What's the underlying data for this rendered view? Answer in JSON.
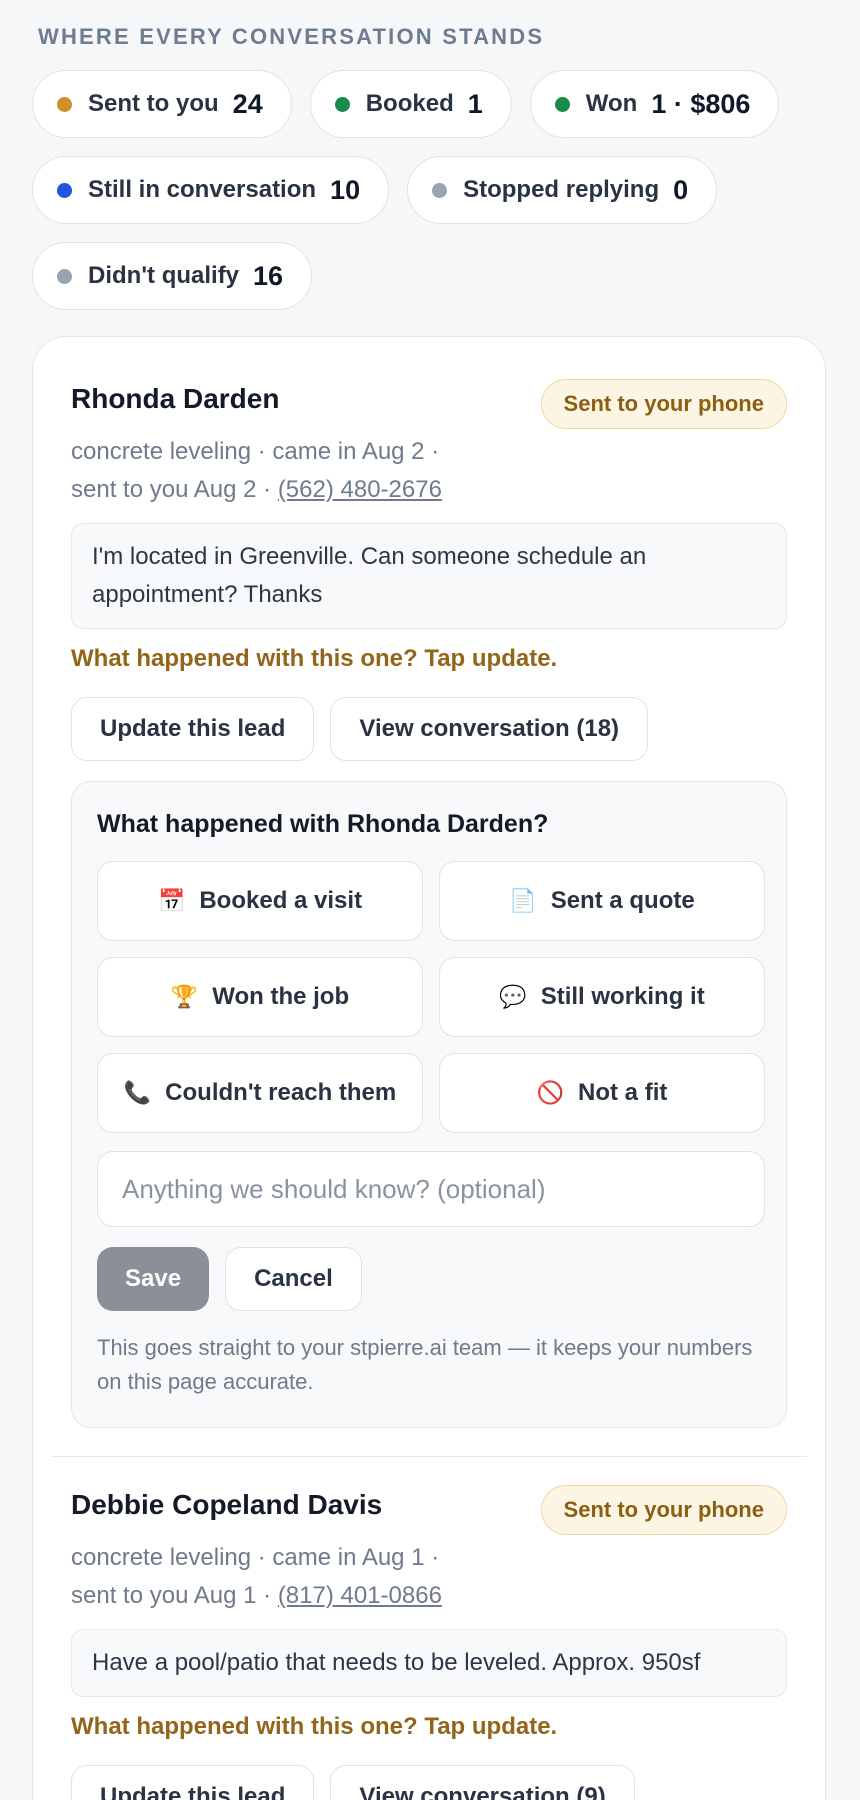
{
  "summary": {
    "heading": "WHERE EVERY CONVERSATION STANDS",
    "chips": [
      {
        "label": "Sent to you",
        "value": "24",
        "color": "#d18f2c"
      },
      {
        "label": "Booked",
        "value": "1",
        "color": "#1a8a4a"
      },
      {
        "label": "Won",
        "value": "1 · $806",
        "color": "#1a8a4a"
      },
      {
        "label": "Still in conversation",
        "value": "10",
        "color": "#1f55e0"
      },
      {
        "label": "Stopped replying",
        "value": "0",
        "color": "#9aa3b2"
      },
      {
        "label": "Didn't qualify",
        "value": "16",
        "color": "#9aa3b2"
      }
    ]
  },
  "leads": [
    {
      "name": "Rhonda Darden",
      "badge": "Sent to your phone",
      "meta_line1": "concrete leveling · came in Aug 2 ·",
      "meta_line2_prefix": "sent to you Aug 2 · ",
      "phone": "(562) 480-2676",
      "message": "I'm located in Greenville. Can someone schedule an appointment? Thanks",
      "prompt": "What happened with this one? Tap update.",
      "update_label": "Update this lead",
      "view_label": "View conversation (18)",
      "panel": {
        "title": "What happened with Rhonda Darden?",
        "options": [
          {
            "icon": "📅",
            "icon_name": "calendar-icon",
            "label": "Booked a visit"
          },
          {
            "icon": "📄",
            "icon_name": "document-icon",
            "label": "Sent a quote"
          },
          {
            "icon": "🏆",
            "icon_name": "trophy-icon",
            "label": "Won the job"
          },
          {
            "icon": "💬",
            "icon_name": "speech-bubble-icon",
            "label": "Still working it"
          },
          {
            "icon": "📞",
            "icon_name": "phone-icon",
            "label": "Couldn't reach them"
          },
          {
            "icon": "🚫",
            "icon_name": "prohibited-icon",
            "label": "Not a fit"
          }
        ],
        "notes_placeholder": "Anything we should know? (optional)",
        "save_label": "Save",
        "cancel_label": "Cancel",
        "footnote": "This goes straight to your stpierre.ai team — it keeps your numbers on this page accurate."
      }
    },
    {
      "name": "Debbie Copeland Davis",
      "badge": "Sent to your phone",
      "meta_line1": "concrete leveling · came in Aug 1 ·",
      "meta_line2_prefix": "sent to you Aug 1 · ",
      "phone": "(817) 401-0866",
      "message": "Have a pool/patio that needs to be leveled. Approx. 950sf",
      "prompt": "What happened with this one? Tap update.",
      "update_label": "Update this lead",
      "view_label": "View conversation (9)"
    }
  ]
}
